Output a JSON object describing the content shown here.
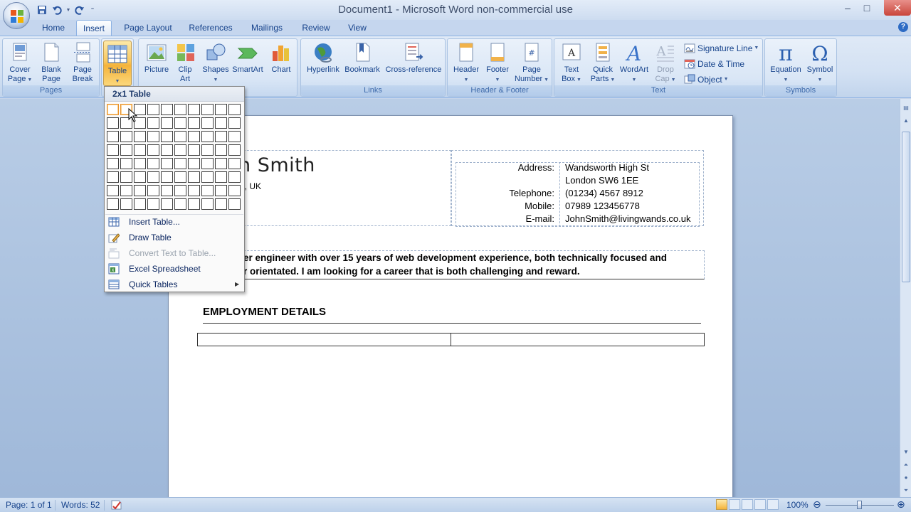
{
  "window": {
    "title": "Document1 - Microsoft Word non-commercial use",
    "minimize": "–",
    "maximize": "□",
    "close": "✕"
  },
  "tabs": [
    {
      "label": "Home"
    },
    {
      "label": "Insert"
    },
    {
      "label": "Page Layout"
    },
    {
      "label": "References"
    },
    {
      "label": "Mailings"
    },
    {
      "label": "Review"
    },
    {
      "label": "View"
    }
  ],
  "ribbon": {
    "pages": {
      "label": "Pages",
      "cover": "Cover\nPage",
      "blank": "Blank\nPage",
      "break": "Page\nBreak"
    },
    "table": {
      "label": "Table"
    },
    "illustrations": {
      "picture": "Picture",
      "clipart": "Clip\nArt",
      "shapes": "Shapes",
      "smartart": "SmartArt",
      "chart": "Chart"
    },
    "links": {
      "label": "Links",
      "hyperlink": "Hyperlink",
      "bookmark": "Bookmark",
      "crossref": "Cross-reference"
    },
    "headerfooter": {
      "label": "Header & Footer",
      "header": "Header",
      "footer": "Footer",
      "pagenum": "Page\nNumber"
    },
    "text": {
      "label": "Text",
      "textbox": "Text\nBox",
      "quickparts": "Quick\nParts",
      "wordart": "WordArt",
      "dropcap": "Drop\nCap",
      "signature": "Signature Line",
      "datetime": "Date & Time",
      "object": "Object"
    },
    "symbols": {
      "label": "Symbols",
      "equation": "Equation",
      "symbol": "Symbol"
    }
  },
  "table_menu": {
    "title": "2x1 Table",
    "grid_cols": 10,
    "grid_rows": 8,
    "selected_cols": 2,
    "selected_rows": 1,
    "items": [
      {
        "label": "Insert Table...",
        "enabled": true
      },
      {
        "label": "Draw Table",
        "enabled": true
      },
      {
        "label": "Convert Text to Table...",
        "enabled": false
      },
      {
        "label": "Excel Spreadsheet",
        "enabled": true
      },
      {
        "label": "Quick Tables",
        "enabled": true
      }
    ]
  },
  "document": {
    "name_partial": "n Smith",
    "location_partial": "6, UK",
    "contact": [
      {
        "label": "Address:",
        "value": "Wandsworth High St"
      },
      {
        "label": "",
        "value": "London SW6 1EE"
      },
      {
        "label": "Telephone:",
        "value": "(01234) 4567 8912"
      },
      {
        "label": "Mobile:",
        "value": "07989 123456778"
      },
      {
        "label": "E-mail:",
        "value": "JohnSmith@livingwands.co.uk"
      }
    ],
    "summary_line1": "er engineer with over 15 years of web development  experience, both technically focused and",
    "summary_line2": "r orientated. I am looking for a career that is both challenging and reward.",
    "employment_heading": "EMPLOYMENT DETAILS"
  },
  "statusbar": {
    "page": "Page: 1 of 1",
    "words": "Words: 52",
    "zoom": "100%"
  },
  "colors": {
    "ribbon_text": "#15428b",
    "table_active": "#f9c85f",
    "grid_highlight": "#e9922b"
  }
}
